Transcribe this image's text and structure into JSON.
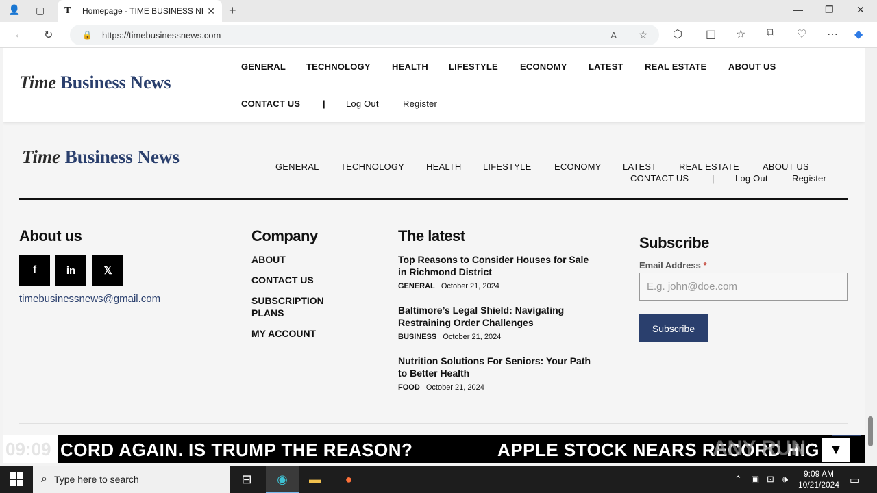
{
  "browser": {
    "tab_title": "Homepage - TIME BUSINESS NEWS",
    "tab_favicon": "T",
    "url": "https://timebusinessnews.com",
    "new_tab": "+",
    "tab_close": "✕"
  },
  "logo": {
    "part1": "Time",
    "part2": "Business News"
  },
  "header_nav": {
    "items": [
      "GENERAL",
      "TECHNOLOGY",
      "HEALTH",
      "LIFESTYLE",
      "ECONOMY",
      "LATEST",
      "REAL ESTATE",
      "ABOUT US",
      "CONTACT US"
    ],
    "separator": "|",
    "logout": "Log Out",
    "register": "Register"
  },
  "footer": {
    "about": {
      "title": "About us",
      "email": "timebusinessnews@gmail.com",
      "socials": [
        "facebook-icon",
        "linkedin-icon",
        "x-icon"
      ]
    },
    "company": {
      "title": "Company",
      "links": [
        "ABOUT",
        "CONTACT US",
        "SUBSCRIPTION PLANS",
        "MY ACCOUNT"
      ]
    },
    "latest": {
      "title": "The latest",
      "articles": [
        {
          "title": "Top Reasons to Consider Houses for Sale in Richmond District",
          "category": "GENERAL",
          "date": "October 21, 2024"
        },
        {
          "title": "Baltimore’s Legal Shield: Navigating Restraining Order Challenges",
          "category": "BUSINESS",
          "date": "October 21, 2024"
        },
        {
          "title": "Nutrition Solutions For Seniors: Your Path to Better Health",
          "category": "FOOD",
          "date": "October 21, 2024"
        }
      ]
    },
    "subscribe": {
      "title": "Subscribe",
      "label": "Email Address",
      "required_mark": "*",
      "placeholder": "E.g. john@doe.com",
      "button": "Subscribe"
    }
  },
  "ticker": {
    "time": "09:09",
    "headline1": "CORD AGAIN. IS TRUMP THE REASON?",
    "headline2": "APPLE STOCK NEARS RECORD HIG",
    "watermark": "ANY RUN"
  },
  "taskbar": {
    "search_placeholder": "Type here to search",
    "time": "9:09 AM",
    "date": "10/21/2024"
  },
  "colors": {
    "brand_blue": "#2a3f6d",
    "ticker_bg": "#000000",
    "taskbar_bg": "#1d1d1d"
  }
}
